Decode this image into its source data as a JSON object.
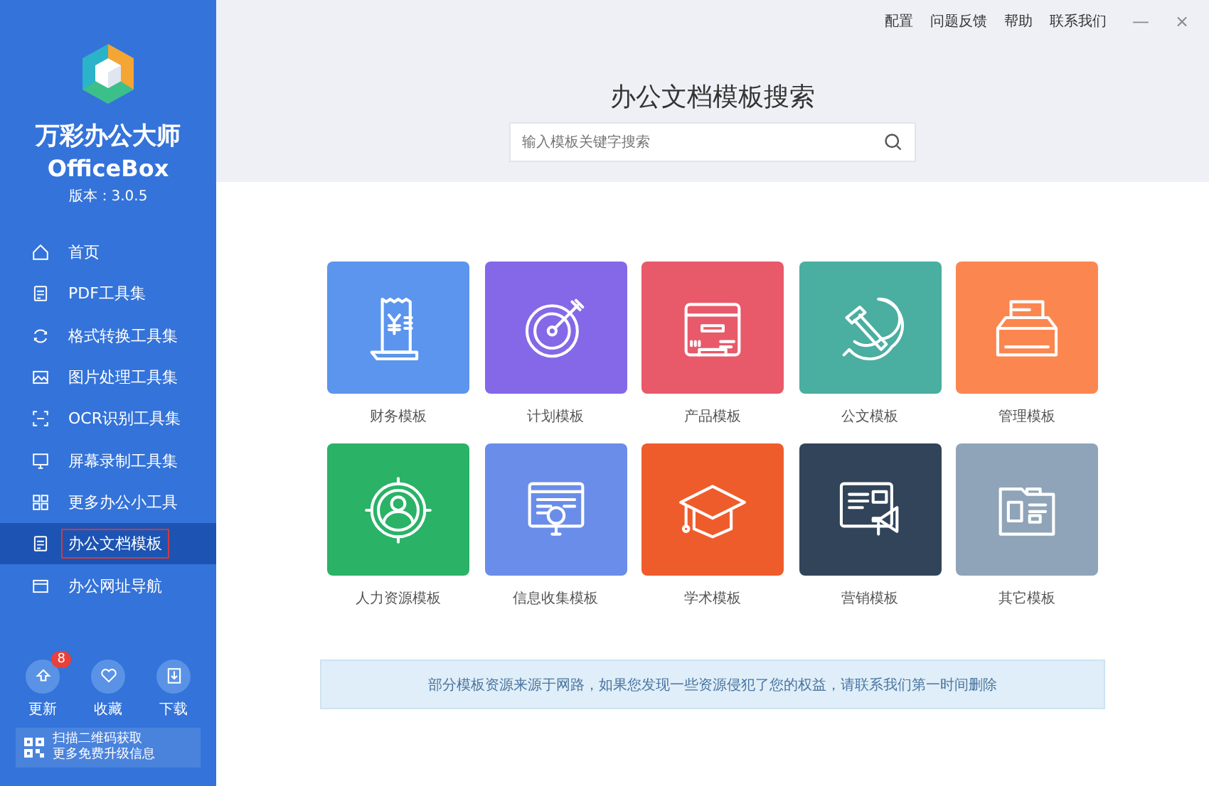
{
  "app": {
    "name": "万彩办公大师",
    "name_en": "OfficeBox",
    "version": "版本：3.0.5"
  },
  "sidebar": {
    "items": [
      {
        "label": "首页",
        "selected": false
      },
      {
        "label": "PDF工具集",
        "selected": false
      },
      {
        "label": "格式转换工具集",
        "selected": false
      },
      {
        "label": "图片处理工具集",
        "selected": false
      },
      {
        "label": "OCR识别工具集",
        "selected": false
      },
      {
        "label": "屏幕录制工具集",
        "selected": false
      },
      {
        "label": "更多办公小工具",
        "selected": false
      },
      {
        "label": "办公文档模板",
        "selected": true
      },
      {
        "label": "办公网址导航",
        "selected": false
      }
    ],
    "actions": [
      {
        "label": "更新",
        "badge": "8"
      },
      {
        "label": "收藏"
      },
      {
        "label": "下载"
      }
    ],
    "qr_text": [
      "扫描二维码获取",
      "更多免费升级信息"
    ]
  },
  "topbar": {
    "links": [
      "配置",
      "问题反馈",
      "帮助",
      "联系我们"
    ],
    "minimize": "—",
    "close": "×"
  },
  "search": {
    "title": "办公文档模板搜索",
    "placeholder": "输入模板关键字搜索"
  },
  "templates": [
    {
      "label": "财务模板",
      "color": "#5b95ee"
    },
    {
      "label": "计划模板",
      "color": "#8468e8"
    },
    {
      "label": "产品模板",
      "color": "#e8596a"
    },
    {
      "label": "公文模板",
      "color": "#4aaea1"
    },
    {
      "label": "管理模板",
      "color": "#fb8650"
    },
    {
      "label": "人力资源模板",
      "color": "#2ab267"
    },
    {
      "label": "信息收集模板",
      "color": "#6a8de9"
    },
    {
      "label": "学术模板",
      "color": "#ef5c2b"
    },
    {
      "label": "营销模板",
      "color": "#314459"
    },
    {
      "label": "其它模板",
      "color": "#8fa4b8"
    }
  ],
  "notice": "部分模板资源来源于网路，如果您发现一些资源侵犯了您的权益，请联系我们第一时间删除"
}
